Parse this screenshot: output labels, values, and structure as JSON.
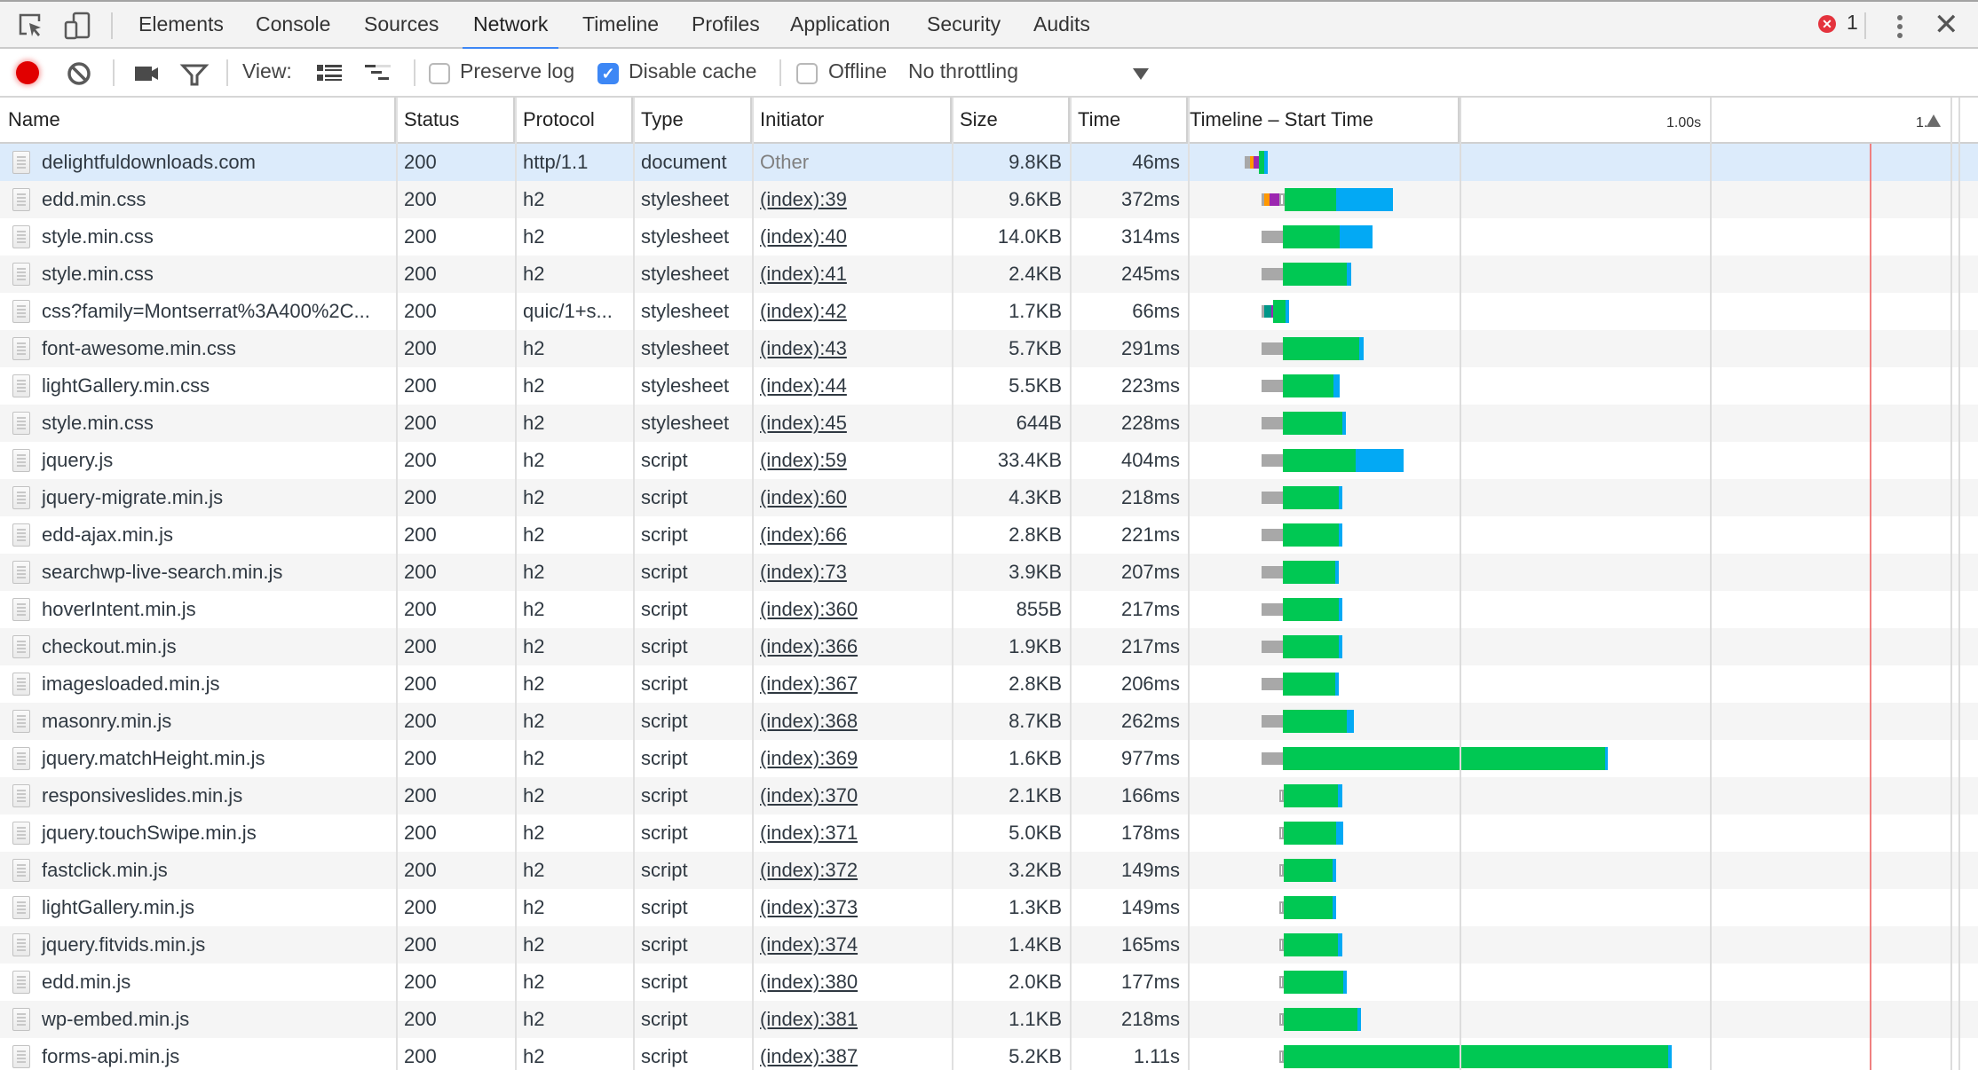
{
  "tabs": [
    {
      "label": "Elements",
      "active": false
    },
    {
      "label": "Console",
      "active": false
    },
    {
      "label": "Sources",
      "active": false
    },
    {
      "label": "Network",
      "active": true
    },
    {
      "label": "Timeline",
      "active": false
    },
    {
      "label": "Profiles",
      "active": false
    },
    {
      "label": "Application",
      "active": false
    },
    {
      "label": "Security",
      "active": false
    },
    {
      "label": "Audits",
      "active": false
    }
  ],
  "error_count": "1",
  "icons": {
    "inspect": "inspect-element-icon",
    "device": "device-mode-icon",
    "record": "record-icon",
    "clear": "clear-icon",
    "capture": "capture-screenshots-icon",
    "filter": "filter-icon",
    "large_rows": "large-rows-icon",
    "waterfall": "overview-icon",
    "error": "error-icon",
    "more": "more-menu-icon",
    "close": "close-icon"
  },
  "toolbar": {
    "view_label": "View:",
    "preserve_log": {
      "label": "Preserve log",
      "checked": false
    },
    "disable_cache": {
      "label": "Disable cache",
      "checked": true
    },
    "offline": {
      "label": "Offline",
      "checked": false
    },
    "throttling": "No throttling"
  },
  "columns": [
    "Name",
    "Status",
    "Protocol",
    "Type",
    "Initiator",
    "Size",
    "Time",
    "Timeline – Start Time"
  ],
  "timeline_ticks": [
    "1.00s",
    "1.…"
  ],
  "colors": {
    "queue": "#a8a8a8",
    "dns": "#009688",
    "connect": "#ff9800",
    "ssl": "#9c27b0",
    "waiting": "#00c853",
    "download": "#03a9f4",
    "load_line": "#f08080",
    "selected_row": "#dcebfb",
    "accent": "#3d87f5"
  },
  "timeline_scale": {
    "ms_at_start": 0,
    "ms_per_gridline": 500,
    "load_event_ms": 1320
  },
  "requests": [
    {
      "name": "delightfuldownloads.com",
      "status": "200",
      "protocol": "http/1.1",
      "type": "document",
      "initiator": "Other",
      "size": "9.8KB",
      "time": "46ms",
      "selected": true,
      "timing": {
        "start": 26,
        "queue": 10,
        "connect": 8,
        "ssl": 10,
        "waiting": 12,
        "download": 6,
        "small": true
      }
    },
    {
      "name": "edd.min.css",
      "status": "200",
      "protocol": "h2",
      "type": "stylesheet",
      "initiator": "(index):39",
      "size": "9.6KB",
      "time": "372ms",
      "timing": {
        "start": 60,
        "queue": 6,
        "connect": 10,
        "ssl": 20,
        "stalled": 10,
        "waiting": 106,
        "download": 115
      }
    },
    {
      "name": "style.min.css",
      "status": "200",
      "protocol": "h2",
      "type": "stylesheet",
      "initiator": "(index):40",
      "size": "14.0KB",
      "time": "314ms",
      "timing": {
        "start": 60,
        "queue": 44,
        "waiting": 115,
        "download": 67
      }
    },
    {
      "name": "style.min.css",
      "status": "200",
      "protocol": "h2",
      "type": "stylesheet",
      "initiator": "(index):41",
      "size": "2.4KB",
      "time": "245ms",
      "timing": {
        "start": 60,
        "queue": 44,
        "waiting": 130,
        "download": 8
      }
    },
    {
      "name": "css?family=Montserrat%3A400%2C...",
      "status": "200",
      "protocol": "quic/1+s...",
      "type": "stylesheet",
      "initiator": "(index):42",
      "size": "1.7KB",
      "time": "66ms",
      "timing": {
        "start": 60,
        "queue": 5,
        "dns": 15,
        "ssl": 2,
        "waiting": 25,
        "download": 7,
        "small": true
      }
    },
    {
      "name": "font-awesome.min.css",
      "status": "200",
      "protocol": "h2",
      "type": "stylesheet",
      "initiator": "(index):43",
      "size": "5.7KB",
      "time": "291ms",
      "timing": {
        "start": 60,
        "queue": 44,
        "waiting": 154,
        "download": 10
      }
    },
    {
      "name": "lightGallery.min.css",
      "status": "200",
      "protocol": "h2",
      "type": "stylesheet",
      "initiator": "(index):44",
      "size": "5.5KB",
      "time": "223ms",
      "timing": {
        "start": 60,
        "queue": 44,
        "waiting": 103,
        "download": 12
      }
    },
    {
      "name": "style.min.css",
      "status": "200",
      "protocol": "h2",
      "type": "stylesheet",
      "initiator": "(index):45",
      "size": "644B",
      "time": "228ms",
      "timing": {
        "start": 60,
        "queue": 44,
        "waiting": 120,
        "download": 8
      }
    },
    {
      "name": "jquery.js",
      "status": "200",
      "protocol": "h2",
      "type": "script",
      "initiator": "(index):59",
      "size": "33.4KB",
      "time": "404ms",
      "timing": {
        "start": 60,
        "queue": 44,
        "waiting": 148,
        "download": 98
      }
    },
    {
      "name": "jquery-migrate.min.js",
      "status": "200",
      "protocol": "h2",
      "type": "script",
      "initiator": "(index):60",
      "size": "4.3KB",
      "time": "218ms",
      "timing": {
        "start": 60,
        "queue": 44,
        "waiting": 113,
        "download": 7
      }
    },
    {
      "name": "edd-ajax.min.js",
      "status": "200",
      "protocol": "h2",
      "type": "script",
      "initiator": "(index):66",
      "size": "2.8KB",
      "time": "221ms",
      "timing": {
        "start": 60,
        "queue": 44,
        "waiting": 113,
        "download": 7
      }
    },
    {
      "name": "searchwp-live-search.min.js",
      "status": "200",
      "protocol": "h2",
      "type": "script",
      "initiator": "(index):73",
      "size": "3.9KB",
      "time": "207ms",
      "timing": {
        "start": 60,
        "queue": 44,
        "waiting": 106,
        "download": 7
      }
    },
    {
      "name": "hoverIntent.min.js",
      "status": "200",
      "protocol": "h2",
      "type": "script",
      "initiator": "(index):360",
      "size": "855B",
      "time": "217ms",
      "timing": {
        "start": 60,
        "queue": 44,
        "waiting": 113,
        "download": 7
      }
    },
    {
      "name": "checkout.min.js",
      "status": "200",
      "protocol": "h2",
      "type": "script",
      "initiator": "(index):366",
      "size": "1.9KB",
      "time": "217ms",
      "timing": {
        "start": 60,
        "queue": 44,
        "waiting": 113,
        "download": 7
      }
    },
    {
      "name": "imagesloaded.min.js",
      "status": "200",
      "protocol": "h2",
      "type": "script",
      "initiator": "(index):367",
      "size": "2.8KB",
      "time": "206ms",
      "timing": {
        "start": 60,
        "queue": 44,
        "waiting": 106,
        "download": 7
      }
    },
    {
      "name": "masonry.min.js",
      "status": "200",
      "protocol": "h2",
      "type": "script",
      "initiator": "(index):368",
      "size": "8.7KB",
      "time": "262ms",
      "timing": {
        "start": 60,
        "queue": 44,
        "waiting": 130,
        "download": 14
      }
    },
    {
      "name": "jquery.matchHeight.min.js",
      "status": "200",
      "protocol": "h2",
      "type": "script",
      "initiator": "(index):369",
      "size": "1.6KB",
      "time": "977ms",
      "timing": {
        "start": 60,
        "queue": 44,
        "waiting": 655,
        "download": 7
      }
    },
    {
      "name": "responsiveslides.min.js",
      "status": "200",
      "protocol": "h2",
      "type": "script",
      "initiator": "(index):370",
      "size": "2.1KB",
      "time": "166ms",
      "timing": {
        "start": 95,
        "queue": 10,
        "waiting": 112,
        "download": 8,
        "hollow": true
      }
    },
    {
      "name": "jquery.touchSwipe.min.js",
      "status": "200",
      "protocol": "h2",
      "type": "script",
      "initiator": "(index):371",
      "size": "5.0KB",
      "time": "178ms",
      "timing": {
        "start": 95,
        "queue": 10,
        "waiting": 107,
        "download": 15,
        "hollow": true
      }
    },
    {
      "name": "fastclick.min.js",
      "status": "200",
      "protocol": "h2",
      "type": "script",
      "initiator": "(index):372",
      "size": "3.2KB",
      "time": "149ms",
      "timing": {
        "start": 95,
        "queue": 10,
        "waiting": 100,
        "download": 7,
        "hollow": true
      }
    },
    {
      "name": "lightGallery.min.js",
      "status": "200",
      "protocol": "h2",
      "type": "script",
      "initiator": "(index):373",
      "size": "1.3KB",
      "time": "149ms",
      "timing": {
        "start": 95,
        "queue": 10,
        "waiting": 100,
        "download": 7,
        "hollow": true
      }
    },
    {
      "name": "jquery.fitvids.min.js",
      "status": "200",
      "protocol": "h2",
      "type": "script",
      "initiator": "(index):374",
      "size": "1.4KB",
      "time": "165ms",
      "timing": {
        "start": 95,
        "queue": 10,
        "waiting": 112,
        "download": 8,
        "hollow": true
      }
    },
    {
      "name": "edd.min.js",
      "status": "200",
      "protocol": "h2",
      "type": "script",
      "initiator": "(index):380",
      "size": "2.0KB",
      "time": "177ms",
      "timing": {
        "start": 95,
        "queue": 10,
        "waiting": 122,
        "download": 8,
        "hollow": true
      }
    },
    {
      "name": "wp-embed.min.js",
      "status": "200",
      "protocol": "h2",
      "type": "script",
      "initiator": "(index):381",
      "size": "1.1KB",
      "time": "218ms",
      "timing": {
        "start": 95,
        "queue": 10,
        "waiting": 151,
        "download": 8,
        "hollow": true
      }
    },
    {
      "name": "forms-api.min.js",
      "status": "200",
      "protocol": "h2",
      "type": "script",
      "initiator": "(index):387",
      "size": "5.2KB",
      "time": "1.11s",
      "timing": {
        "start": 95,
        "queue": 10,
        "waiting": 784,
        "download": 7,
        "hollow": true
      }
    }
  ]
}
